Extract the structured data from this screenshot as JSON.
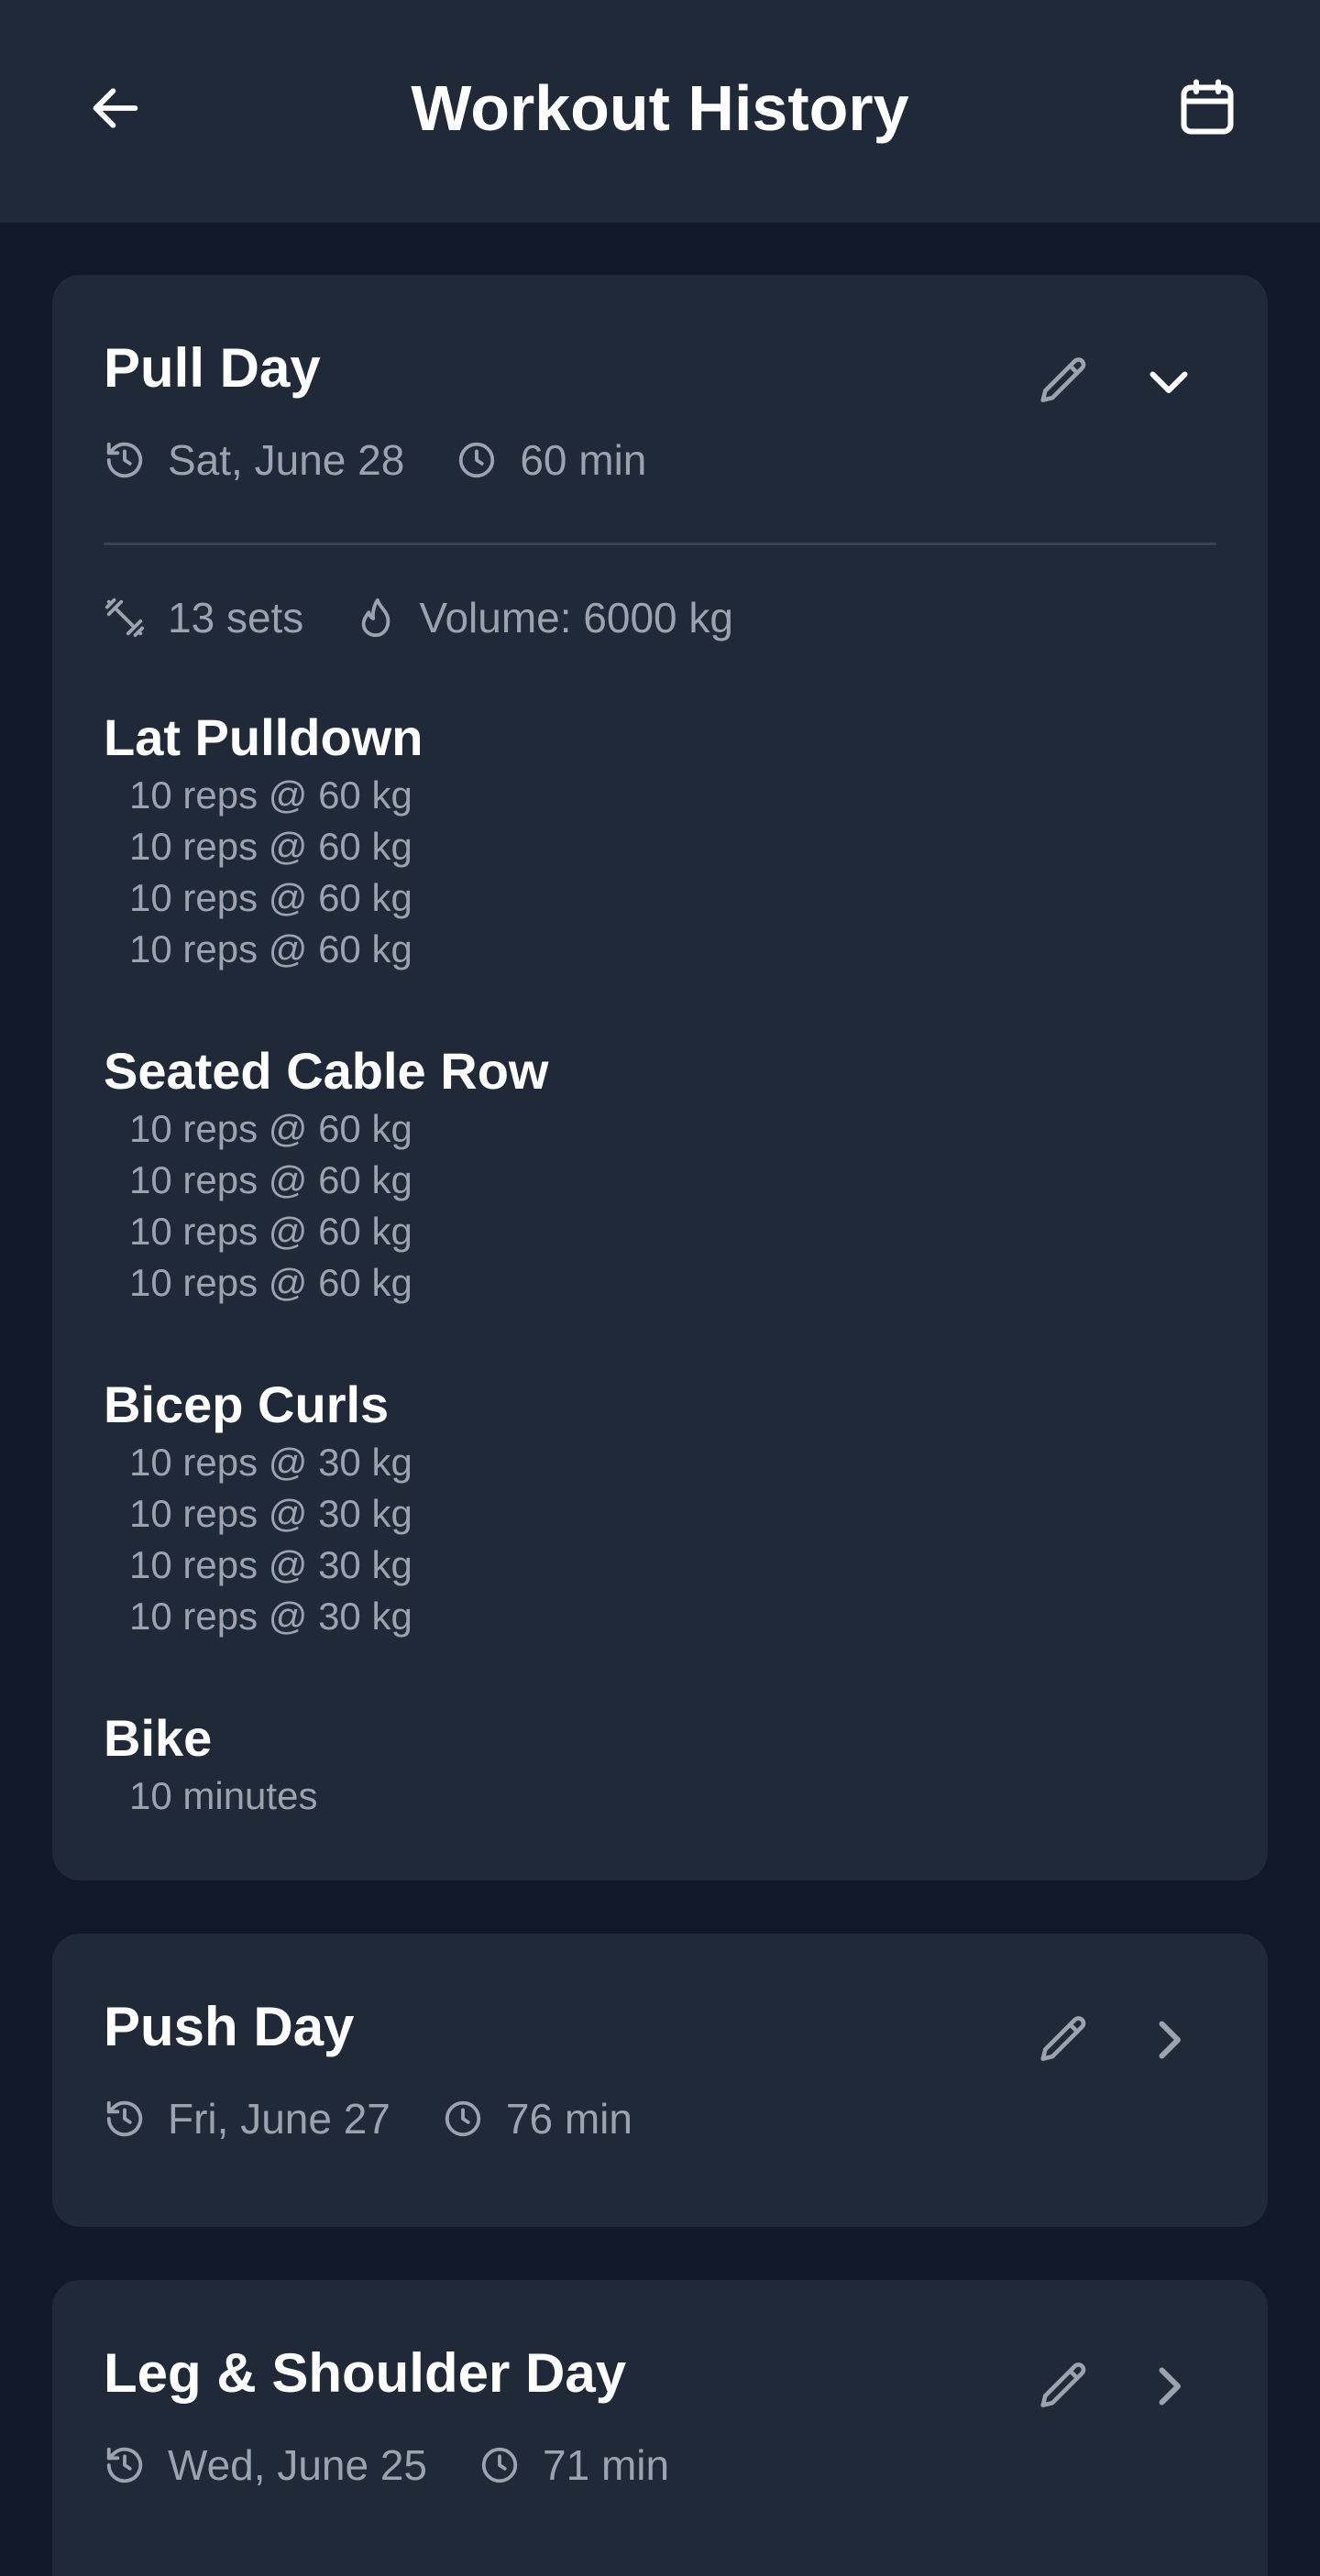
{
  "header": {
    "title": "Workout History",
    "back_icon": "arrow-left-icon",
    "calendar_icon": "calendar-icon"
  },
  "colors": {
    "background": "#111827",
    "card": "#1f2937",
    "text_primary": "#ffffff",
    "text_secondary": "#9ca3af",
    "divider": "#374151"
  },
  "workouts": [
    {
      "name": "Pull Day",
      "date": "Sat, June 28",
      "duration": "60 min",
      "expanded": true,
      "toggle_icon": "chevron-down-icon",
      "sets": "13 sets",
      "volume": "Volume: 6000 kg",
      "exercises": [
        {
          "name": "Lat Pulldown",
          "sets": [
            "10 reps @ 60 kg",
            "10 reps @ 60 kg",
            "10 reps @ 60 kg",
            "10 reps @ 60 kg"
          ]
        },
        {
          "name": "Seated Cable Row",
          "sets": [
            "10 reps @ 60 kg",
            "10 reps @ 60 kg",
            "10 reps @ 60 kg",
            "10 reps @ 60 kg"
          ]
        },
        {
          "name": "Bicep Curls",
          "sets": [
            "10 reps @ 30 kg",
            "10 reps @ 30 kg",
            "10 reps @ 30 kg",
            "10 reps @ 30 kg"
          ]
        },
        {
          "name": "Bike",
          "sets": [
            "10 minutes"
          ]
        }
      ]
    },
    {
      "name": "Push Day",
      "date": "Fri, June 27",
      "duration": "76 min",
      "expanded": false,
      "toggle_icon": "chevron-right-icon"
    },
    {
      "name": "Leg & Shoulder Day",
      "date": "Wed, June 25",
      "duration": "71 min",
      "expanded": false,
      "toggle_icon": "chevron-right-icon"
    }
  ]
}
